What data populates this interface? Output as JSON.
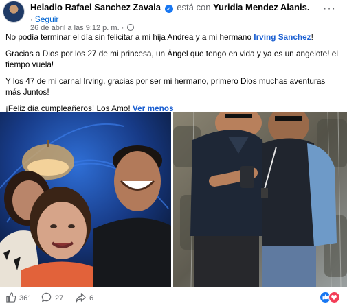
{
  "post": {
    "author": "Heladio Rafael Sanchez Zavala",
    "with_text": "está con",
    "tagged_person": "Yuridia Mendez Alanis.",
    "follow_label": "Seguir",
    "timestamp": "26 de abril a las 9:12 p. m.",
    "separator": "·",
    "more_glyph": "···",
    "paragraph1_before": "No podía terminar el día sin felicitar a mi hija Andrea y a mi hermano ",
    "paragraph1_mention": "Irving Sanchez",
    "paragraph1_after": "!",
    "paragraph2": "Gracias a Dios por los 27 de mi princesa, un Ángel que tengo en vida y ya es un angelote! el tiempo vuela!",
    "paragraph3": "Y los 47 de mi carnal Irving, gracias por ser mi hermano, primero Dios muchas aventuras más Juntos!",
    "paragraph4": "¡Feliz día cumpleañeros! Los Amo!",
    "see_less": "Ver menos"
  },
  "footer": {
    "likes": "361",
    "comments": "27",
    "shares": "6"
  },
  "icons": {
    "more": "more-dots-icon",
    "like": "thumbs-up-icon",
    "comment": "comment-bubble-icon",
    "share": "share-arrow-icon",
    "reaction_like": "reaction-like-icon",
    "reaction_love": "reaction-love-icon"
  },
  "colors": {
    "link": "#1b5fd1",
    "follow": "#0064d1",
    "muted": "#65676b",
    "like_blue": "#1877f2",
    "love_red": "#f33e58"
  }
}
